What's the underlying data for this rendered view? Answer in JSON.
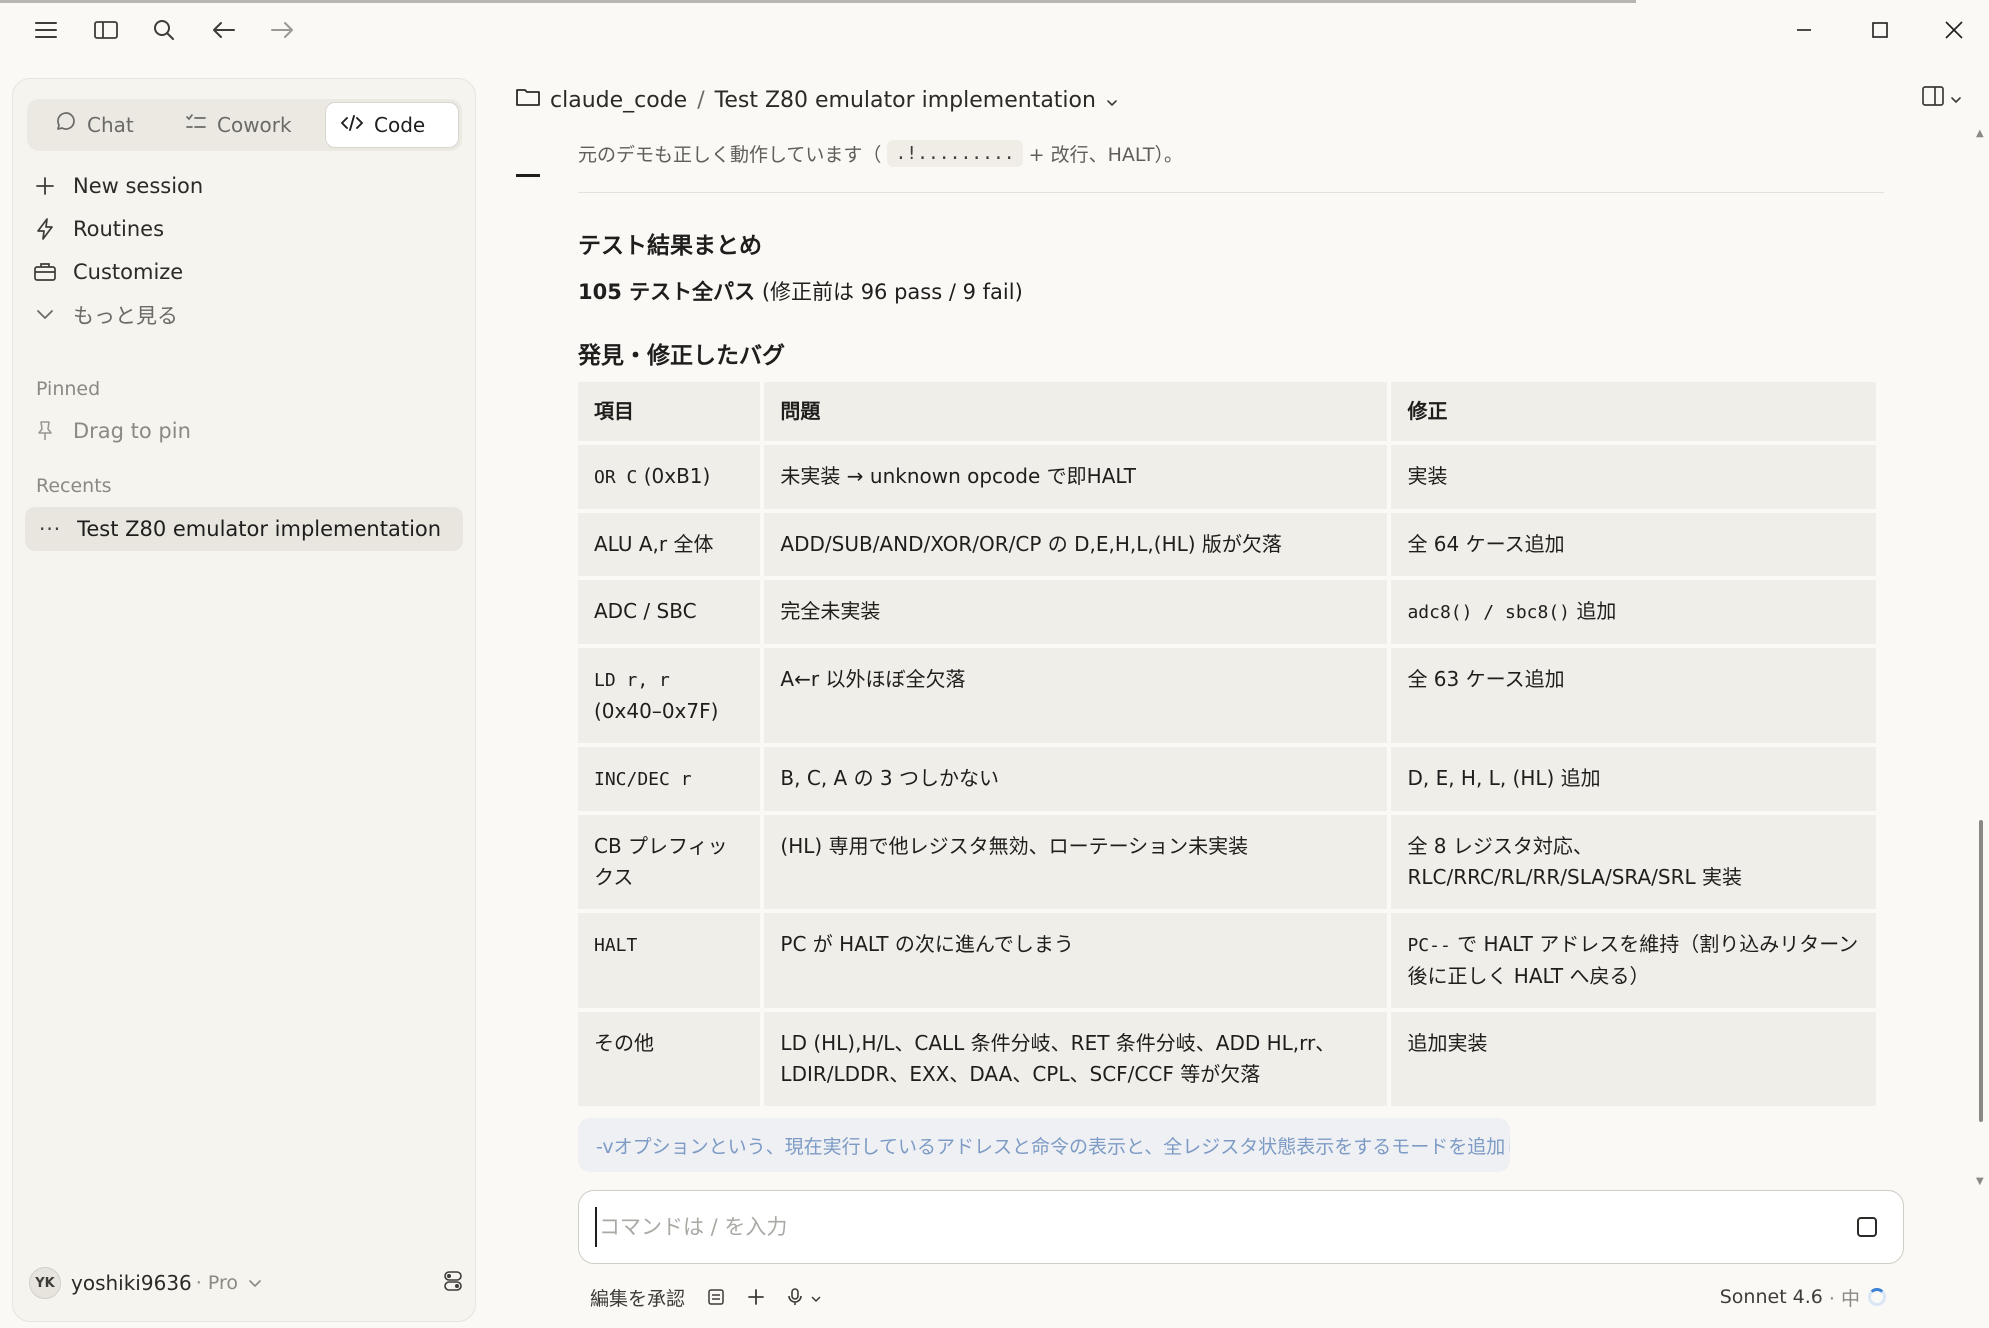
{
  "titlebar": {
    "icons": [
      "menu-icon",
      "sidebar-toggle-icon",
      "search-icon",
      "back-arrow-icon",
      "forward-arrow-icon"
    ],
    "window_controls": [
      "minimize-icon",
      "maximize-icon",
      "close-icon"
    ]
  },
  "sidebar": {
    "modes": [
      {
        "label": "Chat",
        "icon": "chat-bubble-icon",
        "active": false
      },
      {
        "label": "Cowork",
        "icon": "checklist-icon",
        "active": false
      },
      {
        "label": "Code",
        "icon": "code-icon",
        "active": true
      }
    ],
    "nav": [
      {
        "label": "New session",
        "icon": "plus-icon"
      },
      {
        "label": "Routines",
        "icon": "bolt-icon"
      },
      {
        "label": "Customize",
        "icon": "briefcase-icon"
      },
      {
        "label": "もっと見る",
        "icon": "chevron-down-icon"
      }
    ],
    "pinned_label": "Pinned",
    "pin_hint": "Drag to pin",
    "recents_label": "Recents",
    "recent_item": "Test Z80 emulator implementation",
    "user": {
      "initials": "YK",
      "name": "yoshiki9636",
      "plan": "· Pro"
    }
  },
  "header": {
    "folder": "claude_code",
    "separator": "/",
    "session_title": "Test Z80 emulator implementation"
  },
  "content": {
    "prev_text_a": "元のデモも正しく動作しています（",
    "prev_code": ".!.........",
    "prev_text_b": "+ 改行、HALT）。",
    "heading_summary": "テスト結果まとめ",
    "summary_bold": "105 テスト全パス",
    "summary_rest": " (修正前は 96 pass / 9 fail)",
    "heading_bugs": "発見・修正したバグ",
    "table": {
      "headers": [
        "項目",
        "問題",
        "修正"
      ],
      "rows": [
        {
          "item": "OR C",
          "item_extra": " (0xB1)",
          "item_mono": true,
          "problem": "未実装 → unknown opcode で即HALT",
          "fix": "実装",
          "fix_mono": false
        },
        {
          "item": "ALU A,r 全体",
          "item_extra": "",
          "item_mono": false,
          "problem": "ADD/SUB/AND/XOR/OR/CP の D,E,H,L,(HL) 版が欠落",
          "fix": "全 64 ケース追加",
          "fix_mono": false
        },
        {
          "item": "ADC / SBC",
          "item_extra": "",
          "item_mono": false,
          "problem": "完全未実装",
          "fix": "adc8() / sbc8()",
          "fix_extra": " 追加",
          "fix_mono": true
        },
        {
          "item": "LD r, r",
          "item_extra": "(0x40–0x7F)",
          "item_mono": true,
          "item_break": true,
          "problem": "A←r 以外ほぼ全欠落",
          "fix": "全 63 ケース追加",
          "fix_mono": false
        },
        {
          "item": "INC/DEC r",
          "item_extra": "",
          "item_mono": true,
          "problem": "B, C, A の 3 つしかない",
          "fix": "D, E, H, L, (HL) 追加",
          "fix_mono": false
        },
        {
          "item": "CB プレフィックス",
          "item_extra": "",
          "item_mono": false,
          "problem": "(HL) 専用で他レジスタ無効、ローテーション未実装",
          "fix": "全 8 レジスタ対応、RLC/RRC/RL/RR/SLA/SRA/SRL 実装",
          "fix_mono": false
        },
        {
          "item": "HALT",
          "item_extra": "",
          "item_mono": true,
          "problem": "PC が HALT の次に進んでしまう",
          "fix": "PC--",
          "fix_extra": " で HALT アドレスを維持（割り込みリターン後に正しく HALT へ戻る）",
          "fix_mono": true
        },
        {
          "item": "その他",
          "item_extra": "",
          "item_mono": false,
          "problem": "LD (HL),H/L、CALL 条件分岐、RET 条件分岐、ADD HL,rr、LDIR/LDDR、EXX、DAA、CPL、SCF/CCF 等が欠落",
          "fix": "追加実装",
          "fix_mono": false
        }
      ]
    }
  },
  "queued_message": "-vオプションという、現在実行しているアドレスと命令の表示と、全レジスタ状態表示をするモードを追加して。",
  "composer": {
    "placeholder": "コマンドは / を入力",
    "accept_edits_label": "編集を承認",
    "model_label": "Sonnet 4.6",
    "effort_label": "· 中"
  },
  "colors": {
    "background": "#faf9f5",
    "sidebar_bg": "#f5f4ef",
    "table_cell_bg": "#f0eee8",
    "queued_text": "#7d9bc4",
    "spinner_accent": "#3b82d6"
  }
}
